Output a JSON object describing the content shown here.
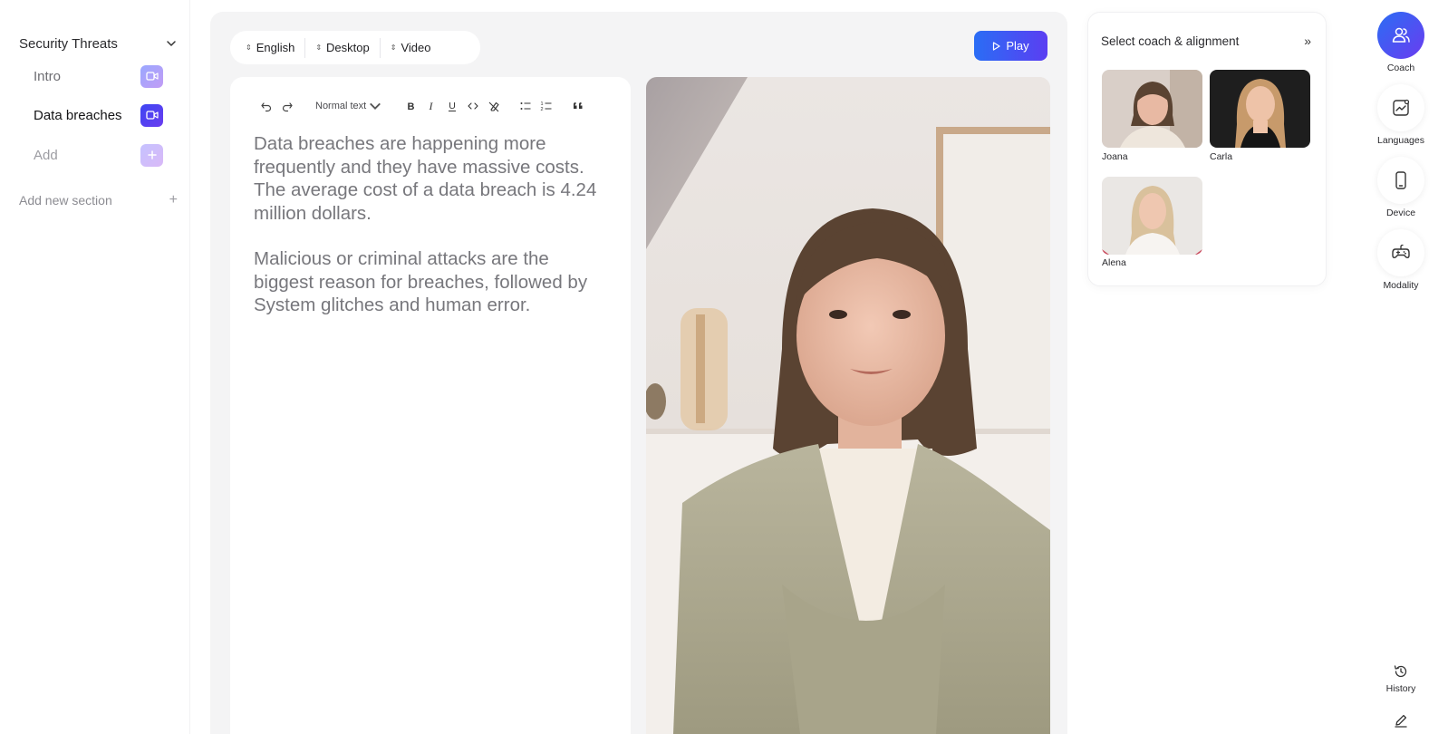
{
  "sidebar": {
    "section_title": "Security Threats",
    "items": [
      {
        "label": "Intro",
        "icon": "video-icon",
        "state": "default"
      },
      {
        "label": "Data breaches",
        "icon": "video-icon",
        "state": "active"
      },
      {
        "label": "Add",
        "icon": "plus-icon",
        "state": "add"
      }
    ],
    "add_section_label": "Add new section",
    "add_section_icon": "+"
  },
  "toolbar": {
    "language": "English",
    "device": "Desktop",
    "modality": "Video",
    "play_label": "Play"
  },
  "editor": {
    "text_style": "Normal text",
    "paragraphs": [
      "Data breaches are happening more frequently and they have massive costs. The average cost of a data breach is 4.24 million dollars.",
      "Malicious or criminal attacks are the biggest reason for breaches, followed by System glitches and human error."
    ]
  },
  "coach_panel": {
    "title": "Select coach & alignment",
    "expand_icon": "»",
    "coaches": [
      {
        "name": "Joana"
      },
      {
        "name": "Carla"
      },
      {
        "name": "Alena"
      }
    ]
  },
  "rail": {
    "coach": "Coach",
    "languages": "Languages",
    "device": "Device",
    "modality": "Modality",
    "history": "History"
  },
  "colors": {
    "accent_start": "#2a6df5",
    "accent_end": "#5b3ef2",
    "panel_bg": "#f4f4f5"
  }
}
